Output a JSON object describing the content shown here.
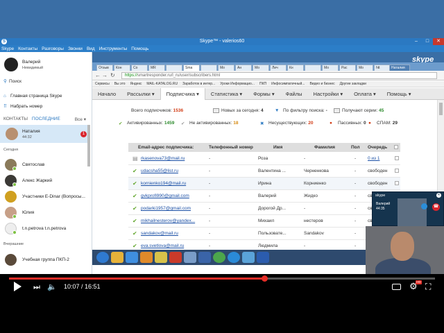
{
  "skype": {
    "window_title": "Skype™ - valerios60",
    "menu": [
      "Skype",
      "Контакты",
      "Разговоры",
      "Звонки",
      "Вид",
      "Инструменты",
      "Помощь"
    ],
    "profile": {
      "name": "Валерий",
      "status": "Невидимый"
    },
    "search_label": "Поиск",
    "home_link": "Главная страница Skype",
    "dial_link": "Набрать номер",
    "tabs": {
      "contacts": "КОНТАКТЫ",
      "recent": "ПОСЛЕДНИЕ",
      "all": "Все"
    },
    "selected": {
      "name": "Наталия",
      "time": "44:32",
      "badge": "1"
    },
    "group_today": "Сегодня",
    "group_yesterday": "Вчерашние",
    "contacts": [
      {
        "name": "Святослав"
      },
      {
        "name": "Алекс Жаркий"
      },
      {
        "name": "Участники E-Dinar (Вопросы..."
      },
      {
        "name": "Юлия"
      },
      {
        "name": "t.n.petrova t.n.petrova"
      },
      {
        "name": "Учебная группа ПКП-2"
      }
    ],
    "taskbar_logo": "skype",
    "call": {
      "caption": "skype",
      "who": "Валерий",
      "time": "44:35"
    }
  },
  "browser": {
    "tabs": [
      "Отзыв",
      "Кон",
      "Со",
      "MR",
      "",
      "Sma",
      "",
      "Mo",
      "Ан",
      "Мо",
      "Лич",
      "Кн",
      "",
      "Мо",
      "Рас",
      "Mo",
      "htt"
    ],
    "tab_active_index": 5,
    "tab_right_label": "Наталия",
    "url_scheme": "https://",
    "url_rest": "smartresponder.ru/l_ru/user/subscribers.html",
    "bookmarks": [
      "Сервисы",
      "Вы это",
      "Яндекс",
      "MAIL-KATALOG.RU",
      "Заработок в интер...",
      "Уроки Информацио...",
      "ПКП",
      "Инфосимпатичный...",
      "Видео и бизнес",
      "Другие закладки"
    ]
  },
  "app": {
    "nav": [
      "Начало",
      "Рассылки ▾",
      "Подписчика ▾",
      "Статистика ▾",
      "Формы ▾",
      "Файлы",
      "Настройки ▾",
      "Оплата ▾",
      "Помощь ▾"
    ],
    "nav_active_index": 2,
    "stats": {
      "total_label": "Всего подписчиков:",
      "total": "1536",
      "new_label": "Новых за сегодня:",
      "new": "4",
      "filter_label": "По фильтру поиска:",
      "filter": "-",
      "series_label": "Получают серии:",
      "series": "45",
      "active_label": "Активированных:",
      "active": "1459",
      "inactive_label": "Не активированных:",
      "inactive": "18",
      "noexist_label": "Несуществующих:",
      "noexist": "20",
      "passive_label": "Пассивных:",
      "passive": "0",
      "spam_label": "СПАМ:",
      "spam": "29"
    },
    "table": {
      "headers": [
        "Email-адрес подписчика:",
        "Телефонный номер",
        "Имя",
        "Фамилия",
        "Пол",
        "Очередь"
      ],
      "rows": [
        {
          "email": "rkasenova73@mail.ru",
          "phone": "-",
          "name": "Роза",
          "surname": "-",
          "sex": "-",
          "queue": "0 из 1",
          "queue_link": true,
          "gray": true
        },
        {
          "email": "udacsha55@list.ru",
          "phone": "-",
          "name": "Валентина ...",
          "surname": "Черненкова",
          "sex": "-",
          "queue": "свободен",
          "queue_link": false,
          "gray": false
        },
        {
          "email": "kornienko194@mail.ru",
          "phone": "-",
          "name": "Ирина",
          "surname": "Корниенко",
          "sex": "-",
          "queue": "свободен",
          "queue_link": false,
          "gray": false
        },
        {
          "email": "gvkprofi990@gmail.com",
          "phone": "-",
          "name": "Валерий",
          "surname": "Жидко",
          "sex": "-",
          "queue": "свободен",
          "queue_link": false,
          "gray": false
        },
        {
          "email": "podarki1957@gmail.com",
          "phone": "-",
          "name": "Дорогой Др...",
          "surname": "-",
          "sex": "-",
          "queue": "своб",
          "queue_link": false,
          "gray": false
        },
        {
          "email": "mikhailnesterov@yandex...",
          "phone": "-",
          "name": "Михаил",
          "surname": "нестеров",
          "sex": "-",
          "queue": "своб",
          "queue_link": false,
          "gray": false
        },
        {
          "email": "sandakov@mail.ru",
          "phone": "-",
          "name": "Пользовате...",
          "surname": "Sandakov",
          "sex": "-",
          "queue": "своб",
          "queue_link": false,
          "gray": false
        },
        {
          "email": "eva.svetlova@mail.ru",
          "phone": "-",
          "name": "Людмила",
          "surname": "-",
          "sex": "-",
          "queue": "",
          "queue_link": false,
          "gray": false
        }
      ]
    }
  },
  "player": {
    "time": "10:07 / 16:51",
    "progress_fraction": 0.6,
    "hd_label": "HD",
    "colors": {
      "progress": "#e52d27"
    }
  }
}
